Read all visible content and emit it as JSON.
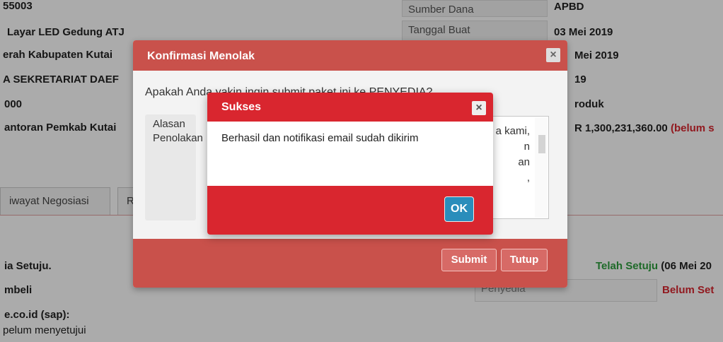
{
  "background": {
    "code": "55003",
    "title": "Layar LED Gedung ATJ",
    "org": "erah Kabupaten Kutai",
    "unit": "A SEKRETARIAT DAEF",
    "amount": "000",
    "location": "antoran Pemkab Kutai",
    "sumber_dana_label": "Sumber Dana",
    "sumber_dana_value": "APBD",
    "tanggal_buat_label": "Tanggal Buat",
    "tanggal_buat_value": "03 Mei 2019",
    "date2": "Mei 2019",
    "year": "19",
    "produk": "roduk",
    "price": "R 1,300,231,360.00",
    "price_note": "(belum s",
    "tabs": [
      "iwayat Negosiasi",
      "R"
    ],
    "row1_label": "ia Setuju.",
    "row1_status_green": "Telah Setuju",
    "row1_status_date": "(06 Mei 20",
    "row2_label": "mbeli",
    "row2_party": "Penyedia",
    "row2_status": "Belum Set",
    "row3_label": "e.co.id (sap):",
    "row4_label": "pelum menyetujui"
  },
  "modal_outer": {
    "title": "Konfirmasi Menolak",
    "question": "Apakah Anda yakin ingin submit paket ini ke PENYEDIA?",
    "reason_label": "Alasan Penolakan",
    "reason_text": "a kami,\nn\nan\n,",
    "submit_label": "Submit",
    "close_label": "Tutup"
  },
  "modal_inner": {
    "title": "Sukses",
    "message": "Berhasil dan notifikasi email sudah dikirim",
    "ok_label": "OK"
  },
  "icons": {
    "close": "close-icon"
  },
  "colors": {
    "danger": "#d9262f",
    "info": "#2a8dbb",
    "success": "#2e9e3e"
  }
}
